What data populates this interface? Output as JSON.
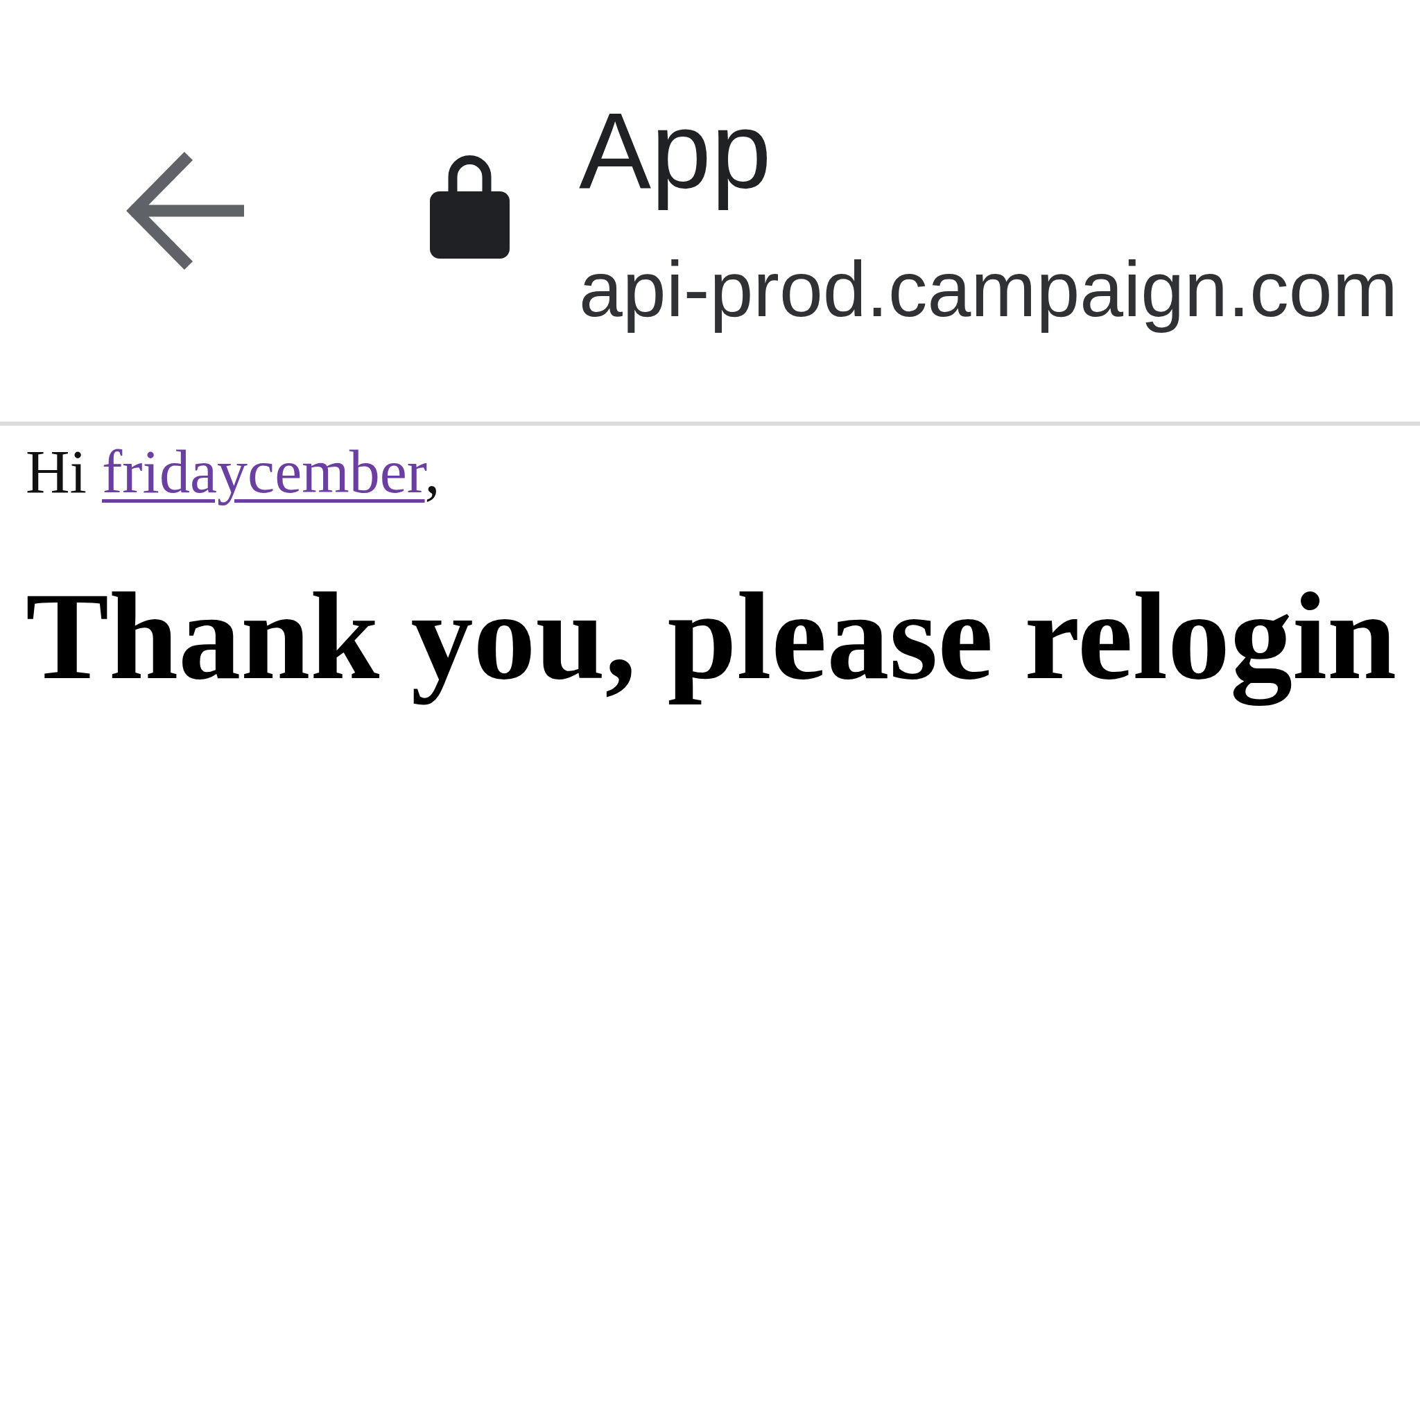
{
  "toolbar": {
    "title": "App",
    "url": "api-prod.campaign.com"
  },
  "page": {
    "greeting": {
      "salutation": "Hi",
      "link": "fridaycember",
      "visited": true,
      "punctuation": ","
    },
    "heading": "Thank you, please relogin"
  }
}
